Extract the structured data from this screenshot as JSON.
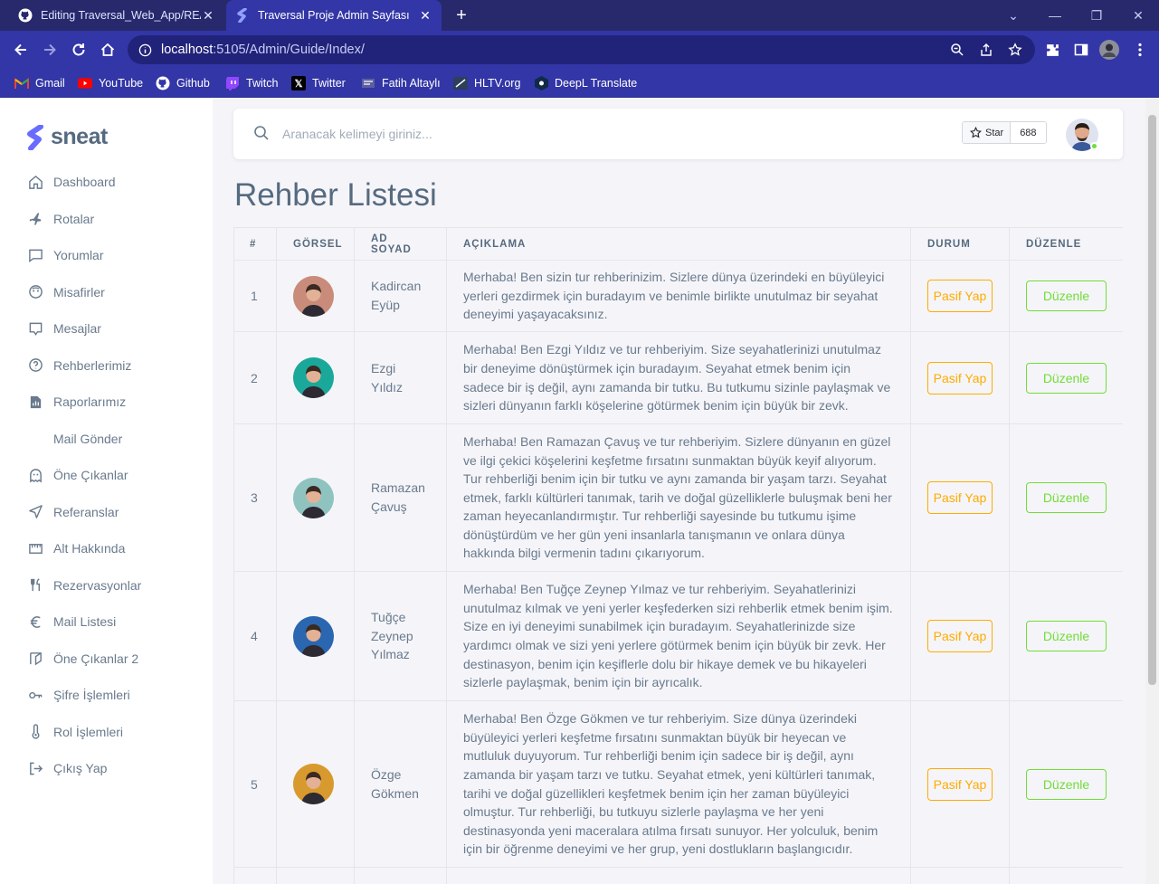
{
  "browser": {
    "tabs": [
      {
        "title": "Editing Traversal_Web_App/READ",
        "icon": "github-icon",
        "active": false
      },
      {
        "title": "Traversal Proje Admin Sayfası",
        "icon": "sneat-icon",
        "active": true
      }
    ],
    "url_host": "localhost",
    "url_path": ":5105/Admin/Guide/Index/",
    "bookmarks": [
      {
        "label": "Gmail",
        "icon": "gmail-icon"
      },
      {
        "label": "YouTube",
        "icon": "youtube-icon"
      },
      {
        "label": "Github",
        "icon": "github-icon"
      },
      {
        "label": "Twitch",
        "icon": "twitch-icon"
      },
      {
        "label": "Twitter",
        "icon": "x-icon"
      },
      {
        "label": "Fatih Altaylı",
        "icon": "bookmark-icon"
      },
      {
        "label": "HLTV.org",
        "icon": "hltv-icon"
      },
      {
        "label": "DeepL Translate",
        "icon": "deepl-icon"
      }
    ]
  },
  "brand": {
    "name": "sneat"
  },
  "sidebar": {
    "items": [
      {
        "label": "Dashboard",
        "icon": "home-icon"
      },
      {
        "label": "Rotalar",
        "icon": "plane-icon"
      },
      {
        "label": "Yorumlar",
        "icon": "comment-icon"
      },
      {
        "label": "Misafirler",
        "icon": "guest-icon"
      },
      {
        "label": "Mesajlar",
        "icon": "message-icon"
      },
      {
        "label": "Rehberlerimiz",
        "icon": "help-icon"
      },
      {
        "label": "Raporlarımız",
        "icon": "report-icon"
      },
      {
        "label": "Mail Gönder",
        "icon": ""
      },
      {
        "label": "Öne Çıkanlar",
        "icon": "ghost-icon"
      },
      {
        "label": "Referanslar",
        "icon": "send-icon"
      },
      {
        "label": "Alt Hakkında",
        "icon": "ruler-icon"
      },
      {
        "label": "Rezervasyonlar",
        "icon": "fork-knife-icon"
      },
      {
        "label": "Mail Listesi",
        "icon": "euro-icon"
      },
      {
        "label": "Öne Çıkanlar 2",
        "icon": "map-icon"
      },
      {
        "label": "Şifre İşlemleri",
        "icon": "key-icon"
      },
      {
        "label": "Rol İşlemleri",
        "icon": "thermometer-icon"
      },
      {
        "label": "Çıkış Yap",
        "icon": "logout-icon"
      }
    ]
  },
  "search": {
    "placeholder": "Aranacak kelimeyi giriniz..."
  },
  "github_star": {
    "label": "Star",
    "count": "688"
  },
  "page": {
    "title": "Rehber Listesi"
  },
  "table": {
    "headers": [
      "#",
      "GÖRSEL",
      "AD SOYAD",
      "AÇIKLAMA",
      "DURUM",
      "DÜZENLE"
    ],
    "rows": [
      {
        "num": "1",
        "name": "Kadircan Eyüp",
        "desc": "Merhaba! Ben sizin tur rehberinizim. Sizlere dünya üzerindeki en büyüleyici yerleri gezdirmek için buradayım ve benimle birlikte unutulmaz bir seyahat deneyimi yaşayacaksınız.",
        "status": "Pasif Yap",
        "edit": "Düzenle",
        "avatar_color": "#c98b7a"
      },
      {
        "num": "2",
        "name": "Ezgi Yıldız",
        "desc": "Merhaba! Ben Ezgi Yıldız ve tur rehberiyim. Size seyahatlerinizi unutulmaz bir deneyime dönüştürmek için buradayım. Seyahat etmek benim için sadece bir iş değil, aynı zamanda bir tutku. Bu tutkumu sizinle paylaşmak ve sizleri dünyanın farklı köşelerine götürmek benim için büyük bir zevk.",
        "status": "Pasif Yap",
        "edit": "Düzenle",
        "avatar_color": "#1aa89a"
      },
      {
        "num": "3",
        "name": "Ramazan Çavuş",
        "desc": "Merhaba! Ben Ramazan Çavuş ve tur rehberiyim. Sizlere dünyanın en güzel ve ilgi çekici köşelerini keşfetme fırsatını sunmaktan büyük keyif alıyorum. Tur rehberliği benim için bir tutku ve aynı zamanda bir yaşam tarzı. Seyahat etmek, farklı kültürleri tanımak, tarih ve doğal güzelliklerle buluşmak beni her zaman heyecanlandırmıştır. Tur rehberliği sayesinde bu tutkumu işime dönüştürdüm ve her gün yeni insanlarla tanışmanın ve onlara dünya hakkında bilgi vermenin tadını çıkarıyorum.",
        "status": "Pasif Yap",
        "edit": "Düzenle",
        "avatar_color": "#8fc3c0"
      },
      {
        "num": "4",
        "name": "Tuğçe Zeynep Yılmaz",
        "desc": "Merhaba! Ben Tuğçe Zeynep Yılmaz ve tur rehberiyim. Seyahatlerinizi unutulmaz kılmak ve yeni yerler keşfederken sizi rehberlik etmek benim işim. Size en iyi deneyimi sunabilmek için buradayım. Seyahatlerinizde size yardımcı olmak ve sizi yeni yerlere götürmek benim için büyük bir zevk. Her destinasyon, benim için keşiflerle dolu bir hikaye demek ve bu hikayeleri sizlerle paylaşmak, benim için bir ayrıcalık.",
        "status": "Pasif Yap",
        "edit": "Düzenle",
        "avatar_color": "#2b66b0"
      },
      {
        "num": "5",
        "name": "Özge Gökmen",
        "desc": "Merhaba! Ben Özge Gökmen ve tur rehberiyim. Size dünya üzerindeki büyüleyici yerleri keşfetme fırsatını sunmaktan büyük bir heyecan ve mutluluk duyuyorum. Tur rehberliği benim için sadece bir iş değil, aynı zamanda bir yaşam tarzı ve tutku. Seyahat etmek, yeni kültürleri tanımak, tarihi ve doğal güzellikleri keşfetmek benim için her zaman büyüleyici olmuştur. Tur rehberliği, bu tutkuyu sizlerle paylaşma ve her yeni destinasyonda yeni maceralara atılma fırsatı sunuyor. Her yolculuk, benim için bir öğrenme deneyimi ve her grup, yeni dostlukların başlangıcıdır.",
        "status": "Pasif Yap",
        "edit": "Düzenle",
        "avatar_color": "#d89a2e"
      }
    ]
  },
  "colors": {
    "primary": "#696cff",
    "warning": "#ffab00",
    "success": "#71dd37",
    "chrome": "#3336a6"
  }
}
